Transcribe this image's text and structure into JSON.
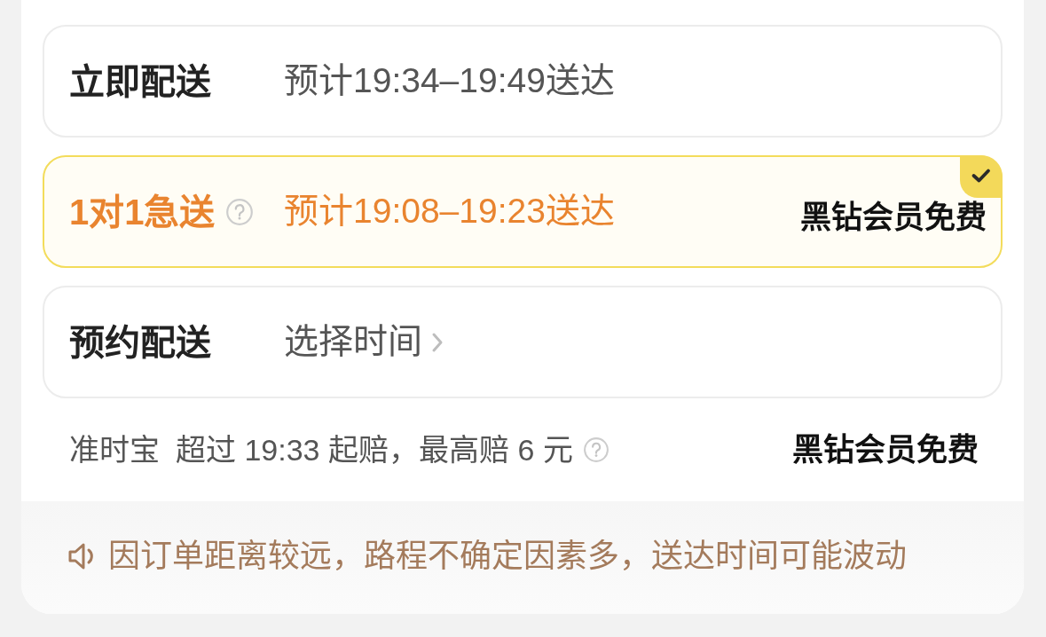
{
  "delivery_options": [
    {
      "kind": "standard",
      "name": "立即配送",
      "time": "预计19:34–19:49送达",
      "selected": false
    },
    {
      "kind": "express",
      "name": "1对1急送",
      "time": "预计19:08–19:23送达",
      "note": "黑钻会员免费",
      "selected": true
    },
    {
      "kind": "scheduled",
      "name": "预约配送",
      "time": "选择时间",
      "selected": false
    }
  ],
  "on_time_guarantee": {
    "label": "准时宝",
    "text": "超过 19:33 起赔，最高赔 6 元",
    "note": "黑钻会员免费"
  },
  "notice": {
    "text": "因订单距离较远，路程不确定因素多，送达时间可能波动"
  }
}
